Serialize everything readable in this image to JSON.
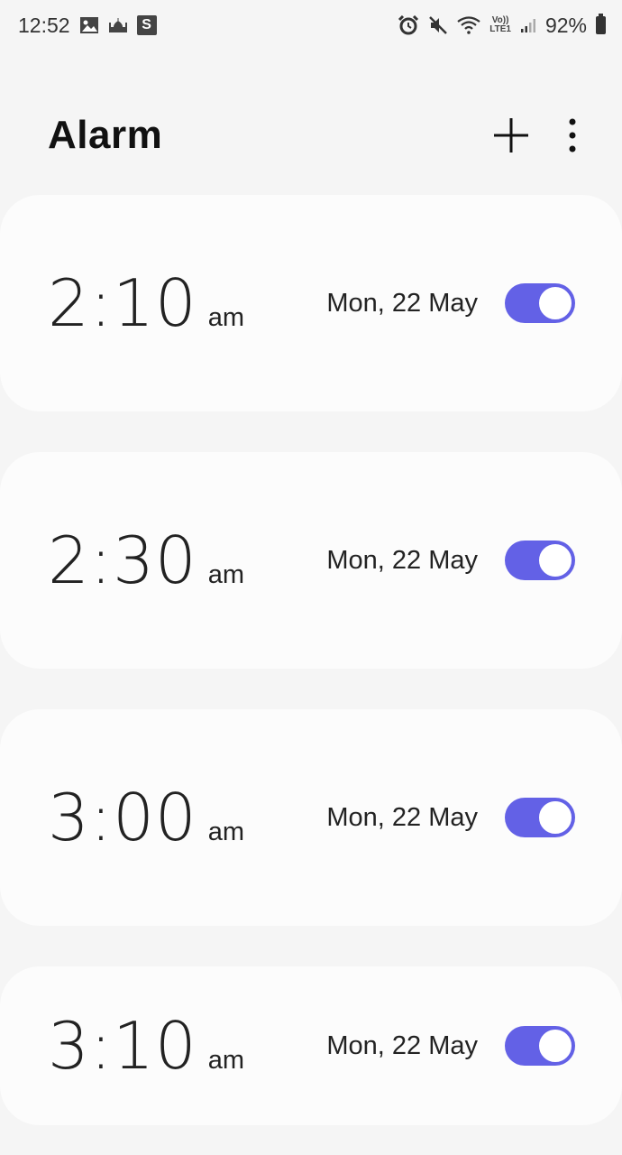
{
  "status_bar": {
    "time": "12:52",
    "s_badge": "S",
    "volte_top": "Vo))",
    "volte_bottom": "LTE1",
    "battery": "92%"
  },
  "header": {
    "title": "Alarm"
  },
  "alarms": [
    {
      "time": "2:10",
      "ampm": "am",
      "date": "Mon, 22 May",
      "enabled": true
    },
    {
      "time": "2:30",
      "ampm": "am",
      "date": "Mon, 22 May",
      "enabled": true
    },
    {
      "time": "3:00",
      "ampm": "am",
      "date": "Mon, 22 May",
      "enabled": true
    },
    {
      "time": "3:10",
      "ampm": "am",
      "date": "Mon, 22 May",
      "enabled": true
    }
  ],
  "colors": {
    "accent": "#6361e6",
    "background": "#f5f5f5",
    "card": "#fcfcfc"
  }
}
